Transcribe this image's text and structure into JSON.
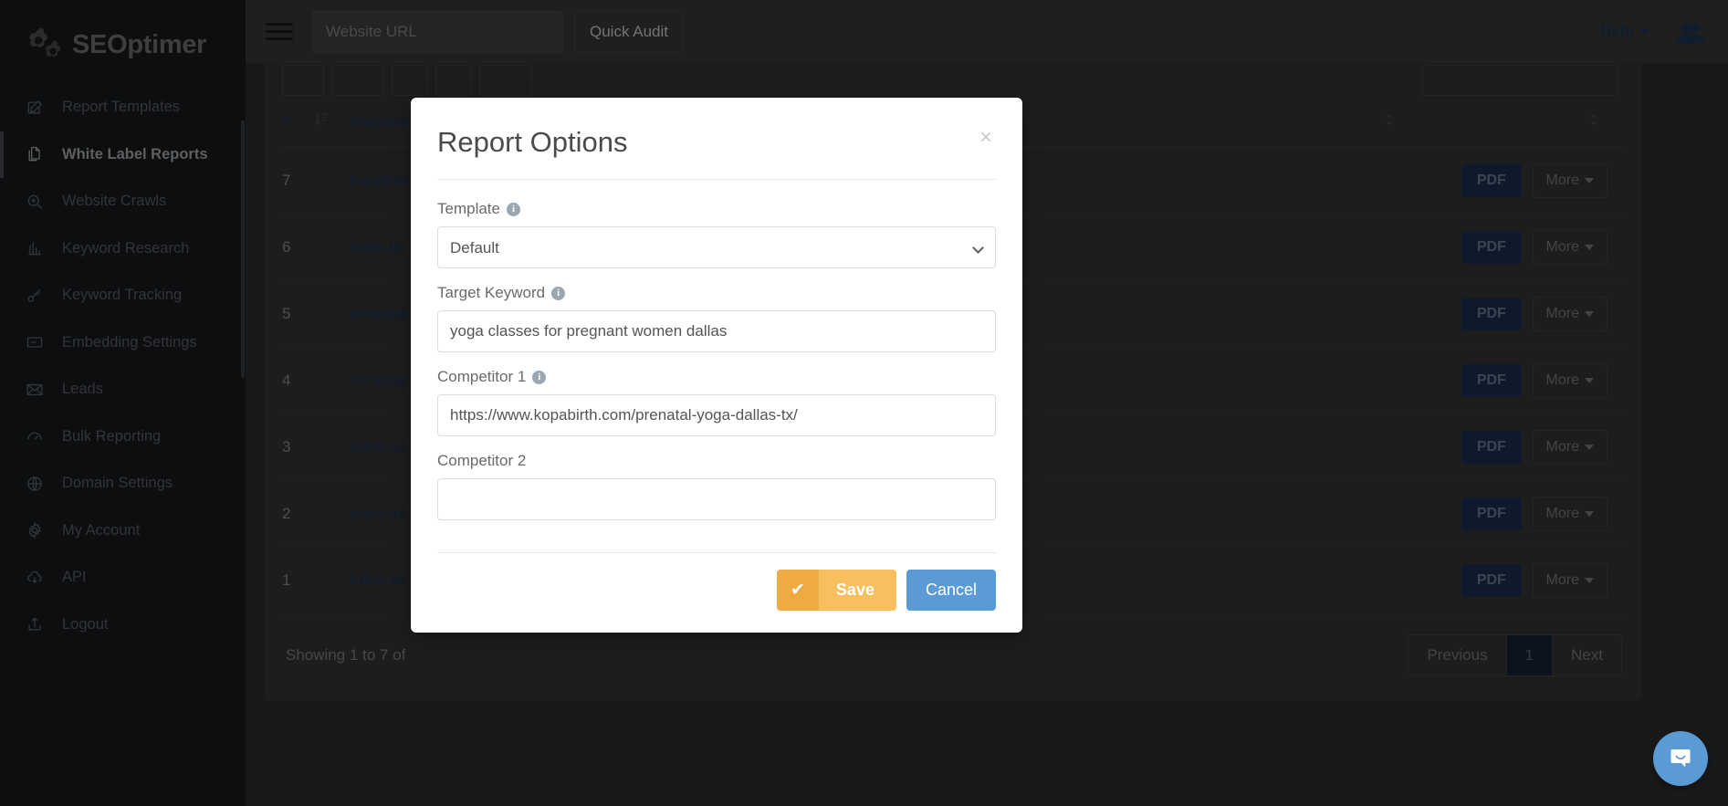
{
  "brand": {
    "name": "SEOptimer",
    "logo_icon": "gear-logo-icon"
  },
  "sidebar": {
    "items": [
      {
        "label": "Report Templates",
        "icon": "pencil-square-icon",
        "active": false
      },
      {
        "label": "White Label Reports",
        "icon": "copy-documents-icon",
        "active": true
      },
      {
        "label": "Website Crawls",
        "icon": "magnifier-plus-icon",
        "active": false
      },
      {
        "label": "Keyword Research",
        "icon": "bar-chart-icon",
        "active": false
      },
      {
        "label": "Keyword Tracking",
        "icon": "key-icon",
        "active": false
      },
      {
        "label": "Embedding Settings",
        "icon": "embed-code-icon",
        "active": false
      },
      {
        "label": "Leads",
        "icon": "envelope-icon",
        "active": false
      },
      {
        "label": "Bulk Reporting",
        "icon": "gauge-icon",
        "active": false
      },
      {
        "label": "Domain Settings",
        "icon": "globe-icon",
        "active": false
      },
      {
        "label": "My Account",
        "icon": "gear-icon",
        "active": false
      },
      {
        "label": "API",
        "icon": "cloud-download-icon",
        "active": false
      },
      {
        "label": "Logout",
        "icon": "logout-upload-icon",
        "active": false
      }
    ]
  },
  "topbar": {
    "menu_icon": "hamburger-icon",
    "url_placeholder": "Website URL",
    "url_value": "",
    "quick_audit_label": "Quick Audit",
    "help_label": "Help",
    "caret_icon": "chevron-down-icon",
    "account_icon": "users-icon"
  },
  "table": {
    "columns": [
      "#",
      "Website",
      "",
      ""
    ],
    "sort_icon": "sort-desc-icon",
    "rows": [
      {
        "num": "7",
        "site": "localran",
        "pdf": "PDF",
        "more": "More"
      },
      {
        "num": "6",
        "site": "www.ju",
        "pdf": "PDF",
        "more": "More"
      },
      {
        "num": "5",
        "site": "ecompe",
        "pdf": "PDF",
        "more": "More"
      },
      {
        "num": "4",
        "site": "rockpap",
        "pdf": "PDF",
        "more": "More"
      },
      {
        "num": "3",
        "site": "www.se",
        "pdf": "PDF",
        "more": "More"
      },
      {
        "num": "2",
        "site": "www.se",
        "pdf": "PDF",
        "more": "More"
      },
      {
        "num": "1",
        "site": "tuberan",
        "pdf": "PDF",
        "more": "More"
      }
    ],
    "showing_text": "Showing 1 to 7 of",
    "pagination": {
      "previous_label": "Previous",
      "page_label": "1",
      "next_label": "Next"
    }
  },
  "modal": {
    "title": "Report Options",
    "close_icon": "close-icon",
    "fields": {
      "template": {
        "label": "Template",
        "info_icon": "info-icon",
        "value": "Default",
        "options": [
          "Default"
        ],
        "caret_icon": "chevron-down-icon"
      },
      "target_keyword": {
        "label": "Target Keyword",
        "info_icon": "info-icon",
        "value": "yoga classes for pregnant women dallas",
        "placeholder": ""
      },
      "competitor_1": {
        "label": "Competitor 1",
        "info_icon": "info-icon",
        "value": "https://www.kopabirth.com/prenatal-yoga-dallas-tx/",
        "placeholder": ""
      },
      "competitor_2": {
        "label": "Competitor 2",
        "value": "",
        "placeholder": ""
      }
    },
    "save_label": "Save",
    "save_icon": "check-icon",
    "cancel_label": "Cancel"
  },
  "intercom": {
    "icon": "chat-bubble-smile-icon"
  },
  "colors": {
    "sidebar_bg": "#161a1d",
    "topbar_bg": "#393939",
    "content_bg": "#2f2f2f",
    "accent_navy": "#1d3557",
    "save_amber": "#f7bf5e",
    "cancel_blue": "#5b9bd5",
    "intercom_blue": "#5b9bd5"
  }
}
